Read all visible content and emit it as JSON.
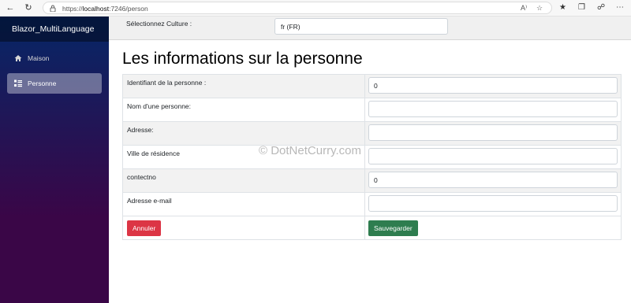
{
  "browser": {
    "url_prefix": "https://",
    "url_host": "localhost",
    "url_path": ":7246/person",
    "read_aloud_label": "A⁾"
  },
  "sidebar": {
    "brand": "Blazor_MultiLanguage",
    "items": [
      {
        "label": "Maison",
        "icon": "home-icon",
        "active": false
      },
      {
        "label": "Personne",
        "icon": "list-icon",
        "active": true
      }
    ]
  },
  "culture": {
    "label": "Sélectionnez Culture :",
    "selected": "fr (FR)"
  },
  "page": {
    "title": "Les informations sur la personne"
  },
  "form": {
    "rows": [
      {
        "label": "Identifiant de la personne :",
        "value": "0"
      },
      {
        "label": "Nom d'une personne:",
        "value": ""
      },
      {
        "label": "Adresse:",
        "value": ""
      },
      {
        "label": "Ville de résidence",
        "value": ""
      },
      {
        "label": "contectno",
        "value": "0"
      },
      {
        "label": "Adresse e-mail",
        "value": ""
      }
    ],
    "cancel_label": "Annuler",
    "save_label": "Sauvegarder"
  },
  "watermark": "© DotNetCurry.com",
  "colors": {
    "sidebar_top": "#052767",
    "sidebar_bottom": "#3a0647",
    "danger": "#dc3545",
    "success": "#2e7d4f"
  }
}
